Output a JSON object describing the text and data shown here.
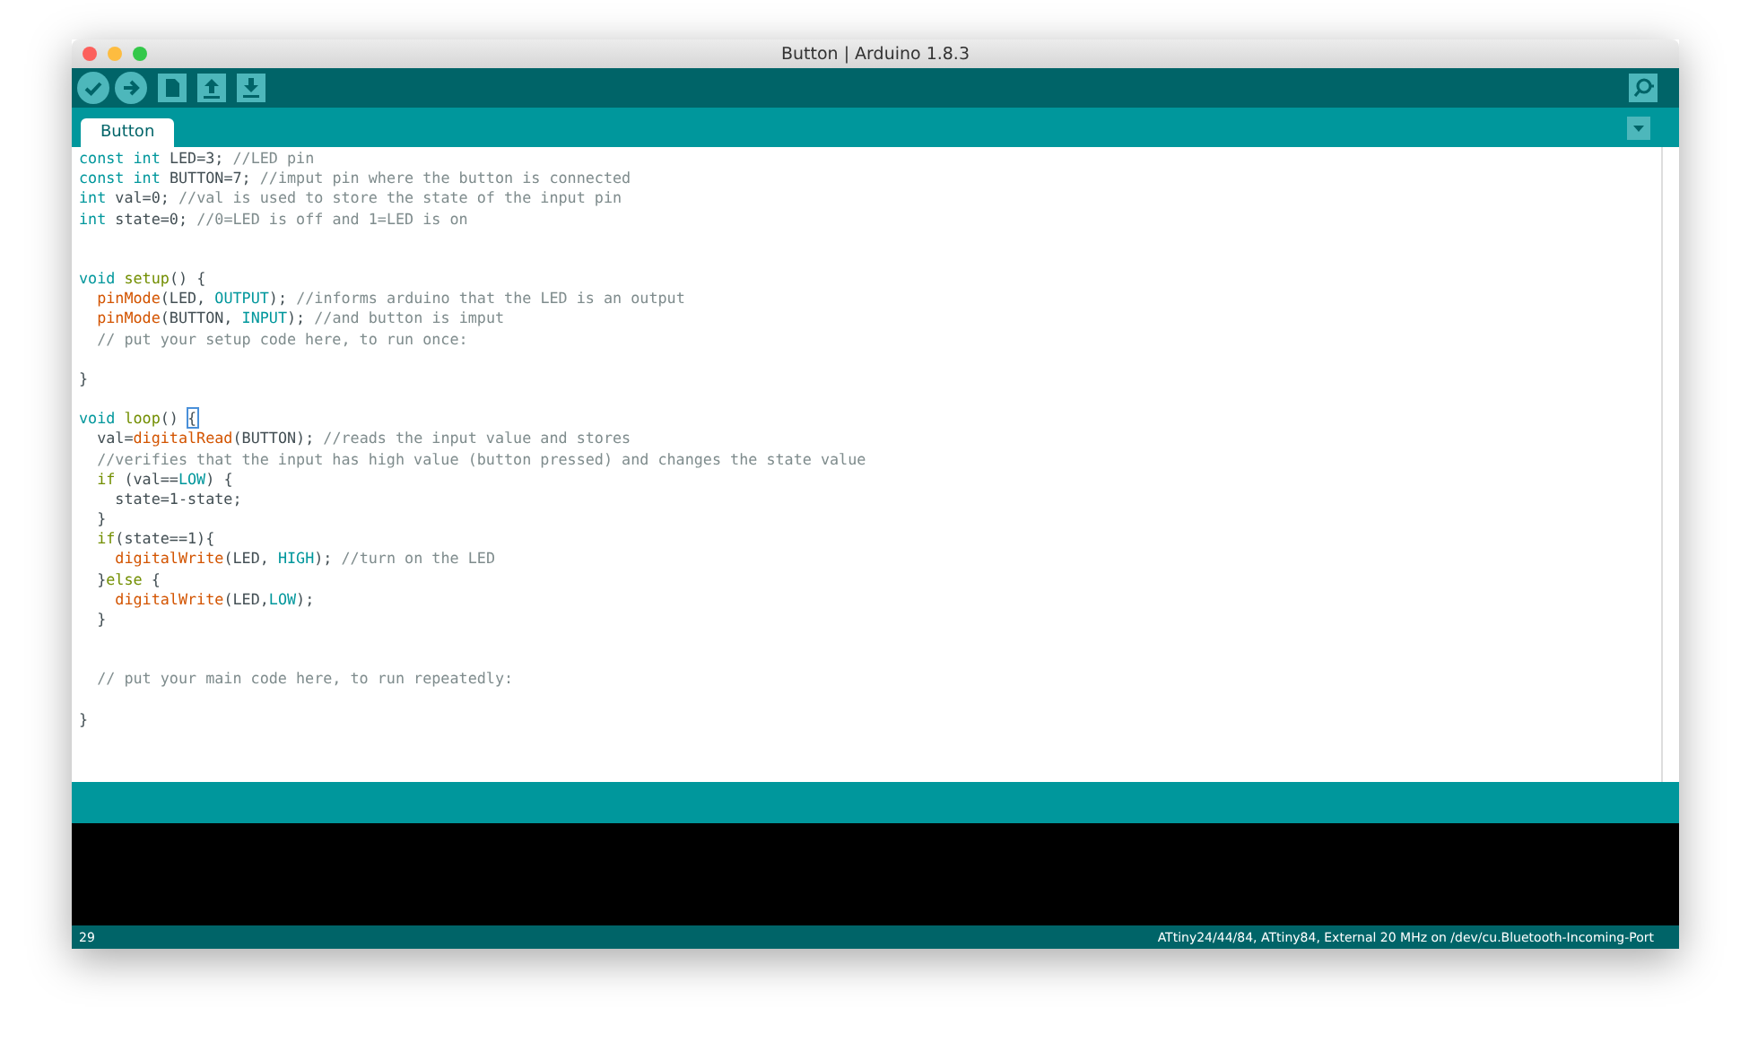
{
  "window": {
    "title": "Button | Arduino 1.8.3"
  },
  "tabs": [
    {
      "label": "Button",
      "selected": true
    }
  ],
  "code_lines": [
    {
      "kind": "code",
      "tokens": [
        {
          "kind": "kw",
          "text": "const "
        },
        {
          "kind": "kw",
          "text": "int"
        },
        {
          "kind": "p",
          "text": " LED=3; "
        },
        {
          "kind": "c",
          "text": "//LED pin"
        }
      ]
    },
    {
      "kind": "code",
      "tokens": [
        {
          "kind": "kw",
          "text": "const "
        },
        {
          "kind": "kw",
          "text": "int"
        },
        {
          "kind": "p",
          "text": " BUTTON=7; "
        },
        {
          "kind": "c",
          "text": "//imput pin where the button is connected"
        }
      ]
    },
    {
      "kind": "code",
      "tokens": [
        {
          "kind": "kw",
          "text": "int"
        },
        {
          "kind": "p",
          "text": " val=0; "
        },
        {
          "kind": "c",
          "text": "//val is used to store the state of the input pin"
        }
      ]
    },
    {
      "kind": "code",
      "tokens": [
        {
          "kind": "kw",
          "text": "int"
        },
        {
          "kind": "p",
          "text": " state=0; "
        },
        {
          "kind": "c",
          "text": "//0=LED is off and 1=LED is on"
        }
      ]
    },
    {
      "kind": "blank"
    },
    {
      "kind": "blank"
    },
    {
      "kind": "code",
      "tokens": [
        {
          "kind": "kw",
          "text": "void "
        },
        {
          "kind": "st",
          "text": "setup"
        },
        {
          "kind": "p",
          "text": "() {"
        }
      ]
    },
    {
      "kind": "code",
      "tokens": [
        {
          "kind": "fn",
          "text": "  pinMode"
        },
        {
          "kind": "p",
          "text": "(LED, "
        },
        {
          "kind": "kw",
          "text": "OUTPUT"
        },
        {
          "kind": "p",
          "text": "); "
        },
        {
          "kind": "c",
          "text": "//informs arduino that the LED is an output"
        }
      ]
    },
    {
      "kind": "code",
      "tokens": [
        {
          "kind": "fn",
          "text": "  pinMode"
        },
        {
          "kind": "p",
          "text": "(BUTTON, "
        },
        {
          "kind": "kw",
          "text": "INPUT"
        },
        {
          "kind": "p",
          "text": "); "
        },
        {
          "kind": "c",
          "text": "//and button is imput"
        }
      ]
    },
    {
      "kind": "code",
      "tokens": [
        {
          "kind": "c",
          "text": "  // put your setup code here, to run once:"
        }
      ]
    },
    {
      "kind": "blank"
    },
    {
      "kind": "code",
      "tokens": [
        {
          "kind": "p",
          "text": "}"
        }
      ]
    },
    {
      "kind": "blank"
    },
    {
      "kind": "code",
      "tokens": [
        {
          "kind": "kw",
          "text": "void "
        },
        {
          "kind": "st",
          "text": "loop"
        },
        {
          "kind": "p",
          "text": "() "
        },
        {
          "kind": "match",
          "text": "{"
        }
      ]
    },
    {
      "kind": "code",
      "tokens": [
        {
          "kind": "p",
          "text": "  val="
        },
        {
          "kind": "fn",
          "text": "digitalRead"
        },
        {
          "kind": "p",
          "text": "(BUTTON); "
        },
        {
          "kind": "c",
          "text": "//reads the input value and stores"
        }
      ]
    },
    {
      "kind": "code",
      "tokens": [
        {
          "kind": "c",
          "text": "  //verifies that the input has high value (button pressed) and changes the state value"
        }
      ]
    },
    {
      "kind": "code",
      "tokens": [
        {
          "kind": "st",
          "text": "  if"
        },
        {
          "kind": "p",
          "text": " (val=="
        },
        {
          "kind": "kw",
          "text": "LOW"
        },
        {
          "kind": "p",
          "text": ") {"
        }
      ]
    },
    {
      "kind": "code",
      "tokens": [
        {
          "kind": "p",
          "text": "    state=1-state;"
        }
      ]
    },
    {
      "kind": "code",
      "tokens": [
        {
          "kind": "p",
          "text": "  }"
        }
      ]
    },
    {
      "kind": "code",
      "tokens": [
        {
          "kind": "st",
          "text": "  if"
        },
        {
          "kind": "p",
          "text": "(state==1){"
        }
      ]
    },
    {
      "kind": "code",
      "tokens": [
        {
          "kind": "fn",
          "text": "    digitalWrite"
        },
        {
          "kind": "p",
          "text": "(LED, "
        },
        {
          "kind": "kw",
          "text": "HIGH"
        },
        {
          "kind": "p",
          "text": "); "
        },
        {
          "kind": "c",
          "text": "//turn on the LED"
        }
      ]
    },
    {
      "kind": "code",
      "tokens": [
        {
          "kind": "p",
          "text": "  }"
        },
        {
          "kind": "st",
          "text": "else"
        },
        {
          "kind": "p",
          "text": " {"
        }
      ]
    },
    {
      "kind": "code",
      "tokens": [
        {
          "kind": "fn",
          "text": "    digitalWrite"
        },
        {
          "kind": "p",
          "text": "(LED,"
        },
        {
          "kind": "kw",
          "text": "LOW"
        },
        {
          "kind": "p",
          "text": ");"
        }
      ]
    },
    {
      "kind": "code",
      "tokens": [
        {
          "kind": "p",
          "text": "  }"
        }
      ]
    },
    {
      "kind": "blank"
    },
    {
      "kind": "blank"
    },
    {
      "kind": "code",
      "tokens": [
        {
          "kind": "c",
          "text": "  // put your main code here, to run repeatedly:"
        }
      ]
    },
    {
      "kind": "blank"
    },
    {
      "kind": "code",
      "tokens": [
        {
          "kind": "p",
          "text": "}"
        }
      ]
    }
  ],
  "status_bar": {
    "line": "29",
    "board": "ATtiny24/44/84, ATtiny84, External 20 MHz on /dev/cu.Bluetooth-Incoming-Port"
  }
}
